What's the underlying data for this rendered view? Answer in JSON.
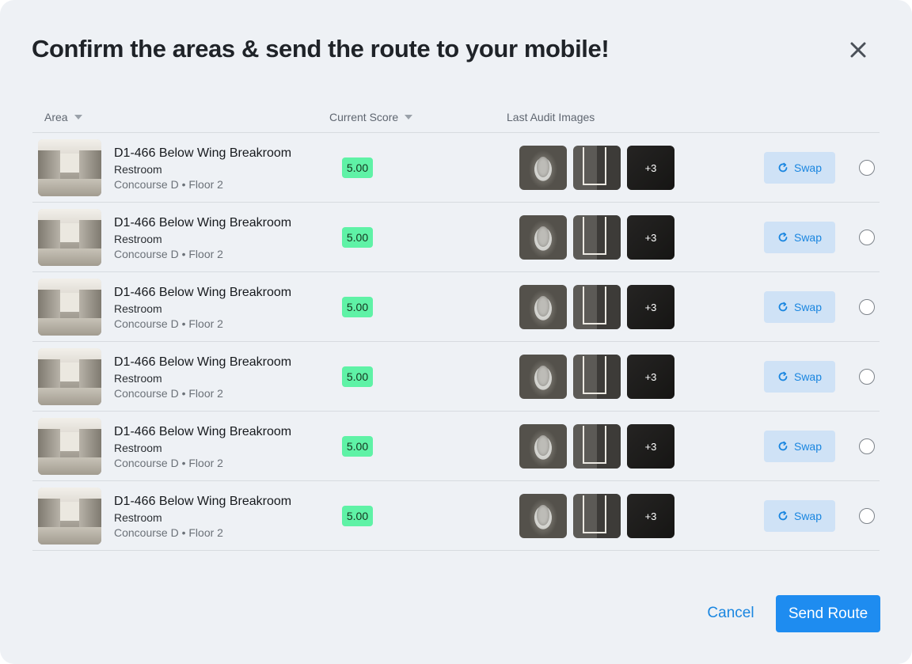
{
  "dialog": {
    "title": "Confirm the areas & send the route to your mobile!"
  },
  "table": {
    "columns": {
      "area": "Area",
      "current_score": "Current Score",
      "last_audit_images": "Last Audit Images"
    },
    "rows": [
      {
        "name": "D1-466 Below Wing Breakroom",
        "type": "Restroom",
        "location": "Concourse D • Floor 2",
        "score": "5.00",
        "more_images": "+3",
        "swap_label": "Swap"
      },
      {
        "name": "D1-466 Below Wing Breakroom",
        "type": "Restroom",
        "location": "Concourse D • Floor 2",
        "score": "5.00",
        "more_images": "+3",
        "swap_label": "Swap"
      },
      {
        "name": "D1-466 Below Wing Breakroom",
        "type": "Restroom",
        "location": "Concourse D • Floor 2",
        "score": "5.00",
        "more_images": "+3",
        "swap_label": "Swap"
      },
      {
        "name": "D1-466 Below Wing Breakroom",
        "type": "Restroom",
        "location": "Concourse D • Floor 2",
        "score": "5.00",
        "more_images": "+3",
        "swap_label": "Swap"
      },
      {
        "name": "D1-466 Below Wing Breakroom",
        "type": "Restroom",
        "location": "Concourse D • Floor 2",
        "score": "5.00",
        "more_images": "+3",
        "swap_label": "Swap"
      },
      {
        "name": "D1-466 Below Wing Breakroom",
        "type": "Restroom",
        "location": "Concourse D • Floor 2",
        "score": "5.00",
        "more_images": "+3",
        "swap_label": "Swap"
      }
    ]
  },
  "footer": {
    "cancel_label": "Cancel",
    "send_label": "Send Route"
  },
  "colors": {
    "accent": "#1e8cf0",
    "score_badge": "#5ff2a6",
    "swap_bg": "#cfe2f6",
    "background": "#eef1f5"
  },
  "icons": {
    "close": "close-icon",
    "sort": "caret-down-icon",
    "swap": "swap-icon"
  }
}
